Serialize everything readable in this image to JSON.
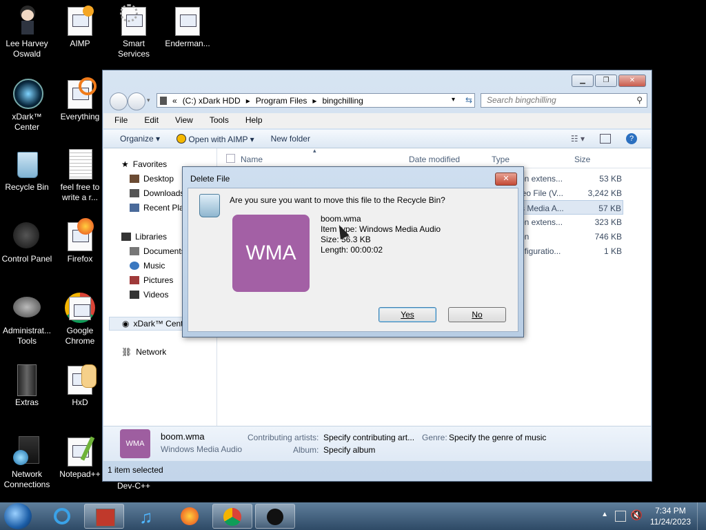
{
  "desktop": {
    "icons": [
      {
        "label": "Lee Harvey Oswald"
      },
      {
        "label": "AIMP"
      },
      {
        "label": "Smart Services"
      },
      {
        "label": "Enderman..."
      },
      {
        "label": "xDark™ Center"
      },
      {
        "label": "Everything"
      },
      {
        "label": "Recycle Bin"
      },
      {
        "label": "feel free to write a r..."
      },
      {
        "label": "Control Panel"
      },
      {
        "label": "Firefox"
      },
      {
        "label": "Administrat... Tools"
      },
      {
        "label": "Google Chrome"
      },
      {
        "label": "Extras"
      },
      {
        "label": "HxD"
      },
      {
        "label": "Network Connections"
      },
      {
        "label": "Notepad++"
      },
      {
        "label": "Dev-C++"
      }
    ]
  },
  "explorer": {
    "address": {
      "prefix": "«",
      "drive": "(C:) xDark HDD",
      "sep": "▸",
      "folder1": "Program Files",
      "folder2": "bingchilling"
    },
    "search_placeholder": "Search bingchilling",
    "menu": {
      "file": "File",
      "edit": "Edit",
      "view": "View",
      "tools": "Tools",
      "help": "Help"
    },
    "commands": {
      "organize": "Organize ▾",
      "open_with": "Open with AIMP ▾",
      "new_folder": "New folder"
    },
    "nav": {
      "favorites": "Favorites",
      "desktop": "Desktop",
      "downloads": "Downloads",
      "recent": "Recent Plac",
      "libraries": "Libraries",
      "documents": "Documents",
      "music": "Music",
      "pictures": "Pictures",
      "videos": "Videos",
      "xdark": "xDark™ Cent",
      "network": "Network"
    },
    "columns": {
      "name": "Name",
      "date": "Date modified",
      "type": "Type",
      "size": "Size"
    },
    "rows": [
      {
        "type": "on extens...",
        "size": "53 KB"
      },
      {
        "type": "leo File (V...",
        "size": "3,242 KB"
      },
      {
        "type": "s Media A...",
        "size": "57 KB"
      },
      {
        "type": "on extens...",
        "size": "323 KB"
      },
      {
        "type": "on",
        "size": "746 KB"
      },
      {
        "type": "nfiguratio...",
        "size": "1 KB"
      }
    ],
    "details": {
      "thumb": "WMA",
      "name": "boom.wma",
      "kind": "Windows Media Audio",
      "artists_label": "Contributing artists:",
      "artists_value": "Specify contributing art...",
      "genre_label": "Genre:",
      "genre_value": "Specify the genre of music",
      "album_label": "Album:",
      "album_value": "Specify album"
    },
    "status": "1 item selected"
  },
  "dialog": {
    "title": "Delete File",
    "question": "Are you sure you want to move this file to the Recycle Bin?",
    "thumb": "WMA",
    "filename": "boom.wma",
    "item_type": "Item type: Windows Media Audio",
    "size": "Size: 56.3 KB",
    "length": "Length: 00:00:02",
    "yes": "Yes",
    "no": "No"
  },
  "taskbar": {
    "time": "7:34 PM",
    "date": "11/24/2023"
  },
  "colors": {
    "wma": "#a360a5",
    "accent": "#3c7fb1"
  }
}
